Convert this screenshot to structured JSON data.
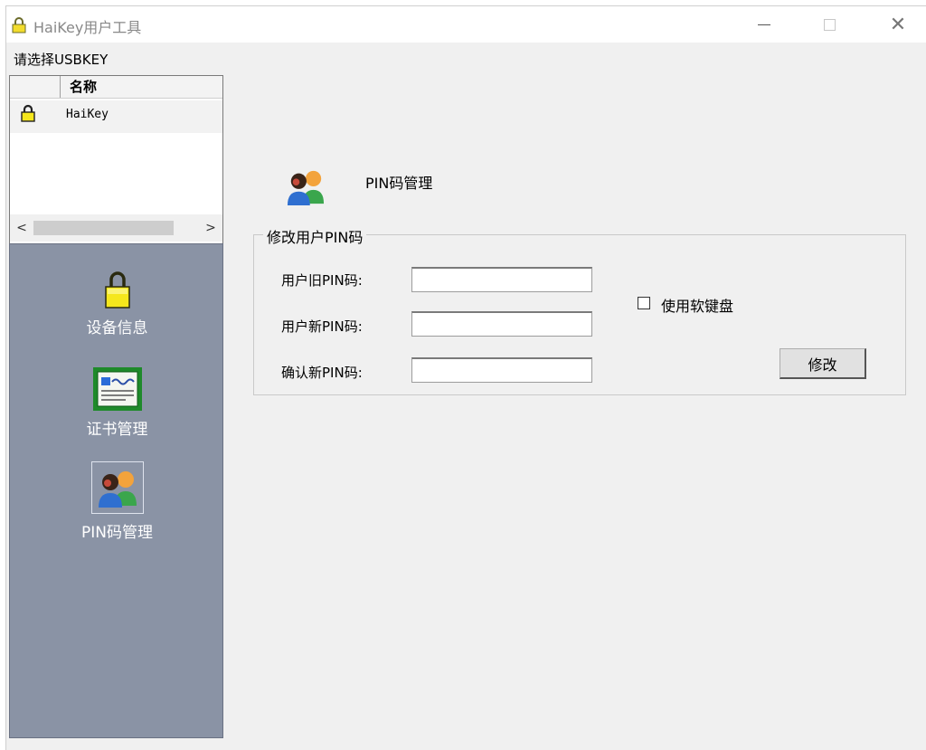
{
  "window": {
    "title": "HaiKey用户工具",
    "controls": {
      "minimize": "—",
      "maximize": "☐",
      "close": "✕"
    }
  },
  "device_list": {
    "prompt": "请选择USBKEY",
    "column_header": "名称",
    "rows": [
      {
        "name": "HaiKey",
        "icon": "lock-icon"
      }
    ],
    "scroll_left": "<",
    "scroll_right": ">"
  },
  "nav": {
    "items": [
      {
        "label": "设备信息",
        "icon": "lock-icon"
      },
      {
        "label": "证书管理",
        "icon": "certificate-icon"
      },
      {
        "label": "PIN码管理",
        "icon": "users-icon"
      }
    ]
  },
  "pin_panel": {
    "title": "PIN码管理",
    "group_title": "修改用户PIN码",
    "old_pin_label": "用户旧PIN码:",
    "new_pin_label": "用户新PIN码:",
    "confirm_pin_label": "确认新PIN码:",
    "old_pin_value": "",
    "new_pin_value": "",
    "confirm_pin_value": "",
    "soft_keyboard_label": "使用软键盘",
    "soft_keyboard_checked": false,
    "modify_button": "修改"
  },
  "colors": {
    "nav_background": "#8a93a5",
    "lock_yellow": "#f5e71c",
    "window_background": "#f0f0f0"
  }
}
